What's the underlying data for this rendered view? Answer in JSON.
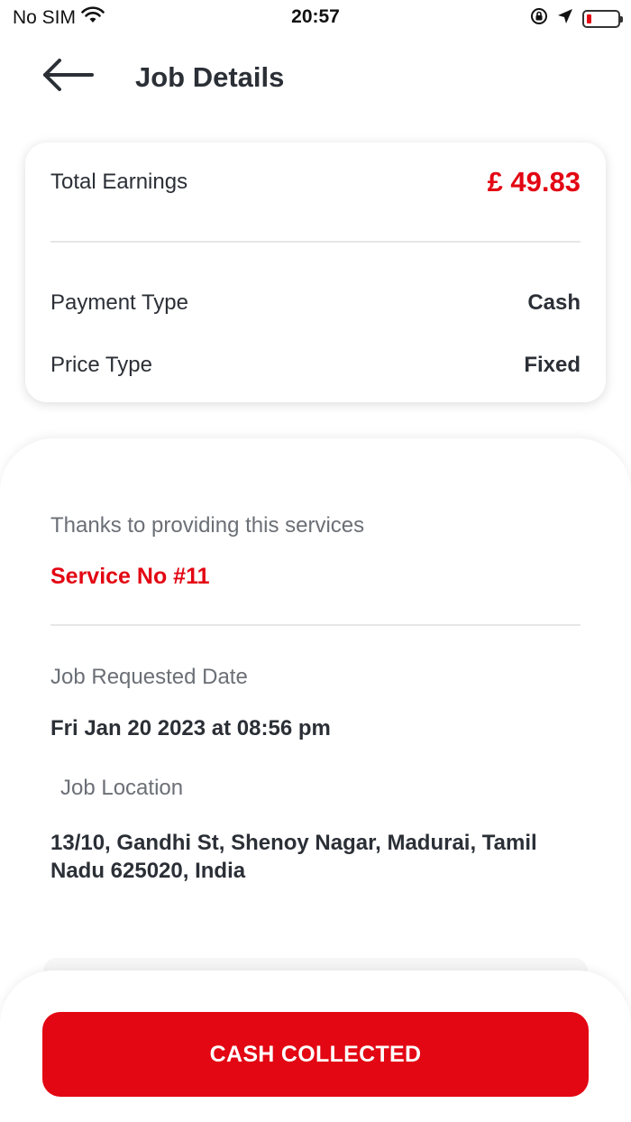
{
  "status_bar": {
    "carrier": "No SIM",
    "time": "20:57"
  },
  "header": {
    "title": "Job Details"
  },
  "earnings": {
    "total_label": "Total Earnings",
    "total_value": "£ 49.83",
    "payment_type_label": "Payment Type",
    "payment_type_value": "Cash",
    "price_type_label": "Price Type",
    "price_type_value": "Fixed"
  },
  "details": {
    "thanks_text": "Thanks to providing this services",
    "service_no": "Service No #11",
    "requested_date_label": "Job Requested Date",
    "requested_date_value": "Fri Jan 20 2023 at 08:56 pm",
    "location_label": "Job Location",
    "location_value": "13/10, Gandhi St, Shenoy Nagar, Madurai, Tamil Nadu 625020, India"
  },
  "actions": {
    "cash_collected_label": "CASH COLLECTED"
  },
  "colors": {
    "accent": "#e30613",
    "text": "#2b2f36",
    "muted": "#6b6f76"
  }
}
